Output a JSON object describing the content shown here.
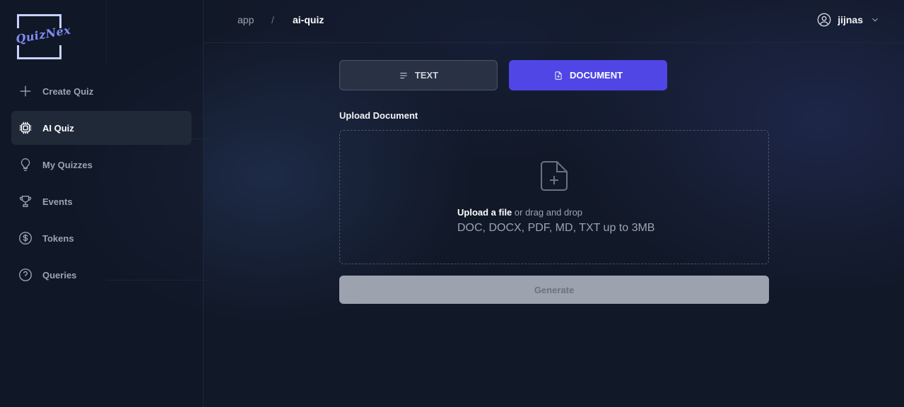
{
  "brand": {
    "logo_text": "QuizNex",
    "accent": "#4f46e5"
  },
  "sidebar": {
    "items": [
      {
        "label": "Create Quiz",
        "icon": "plus-icon"
      },
      {
        "label": "AI Quiz",
        "icon": "cpu-chip-icon",
        "active": true
      },
      {
        "label": "My Quizzes",
        "icon": "lightbulb-icon"
      },
      {
        "label": "Events",
        "icon": "trophy-icon"
      },
      {
        "label": "Tokens",
        "icon": "dollar-circle-icon"
      },
      {
        "label": "Queries",
        "icon": "question-circle-icon"
      }
    ]
  },
  "breadcrumb": {
    "root": "app",
    "separator": "/",
    "current": "ai-quiz"
  },
  "user": {
    "name": "jijnas",
    "icon": "user-circle-icon"
  },
  "tabs": {
    "text_label": "TEXT",
    "document_label": "DOCUMENT",
    "selected": "DOCUMENT"
  },
  "upload": {
    "label": "Upload Document",
    "link_text": "Upload a file",
    "rest_text": " or drag and drop",
    "formats": "DOC, DOCX, PDF, MD, TXT up to 3MB"
  },
  "generate_label": "Generate"
}
